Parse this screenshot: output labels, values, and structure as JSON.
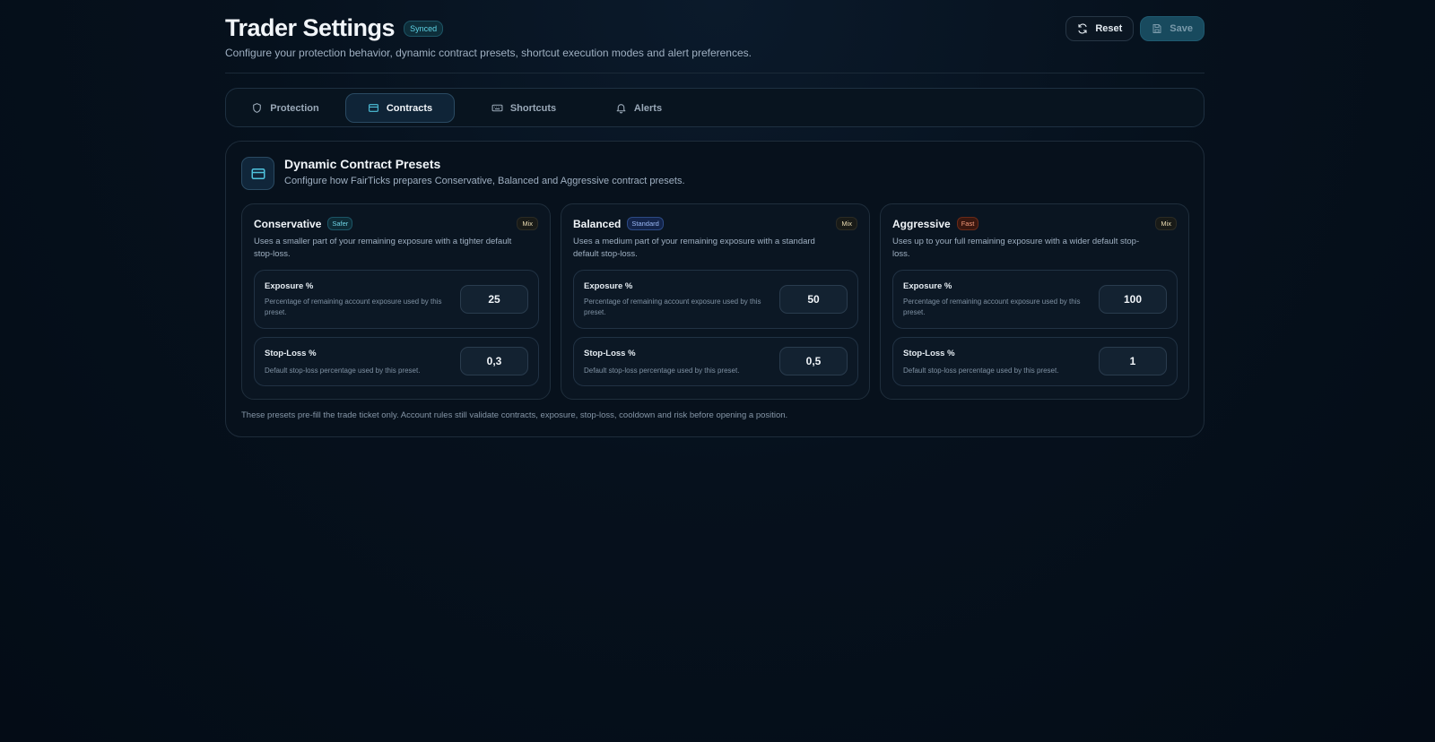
{
  "header": {
    "title": "Trader Settings",
    "status_badge": "Synced",
    "subtitle": "Configure your protection behavior, dynamic contract presets, shortcut execution modes and alert preferences.",
    "reset_label": "Reset",
    "save_label": "Save"
  },
  "tabs": [
    {
      "label": "Protection",
      "icon": "shield-icon"
    },
    {
      "label": "Contracts",
      "icon": "card-icon",
      "active": true
    },
    {
      "label": "Shortcuts",
      "icon": "keyboard-icon"
    },
    {
      "label": "Alerts",
      "icon": "bell-icon"
    }
  ],
  "panel": {
    "title": "Dynamic Contract Presets",
    "description": "Configure how FairTicks prepares Conservative, Balanced and Aggressive contract presets.",
    "footnote": "These presets pre-fill the trade ticket only. Account rules still validate contracts, exposure, stop-loss, cooldown and risk before opening a position.",
    "presets": [
      {
        "name": "Conservative",
        "tag": "Safer",
        "mix": "Mix",
        "description": "Uses a smaller part of your remaining exposure with a tighter default stop-loss.",
        "exposure_label": "Exposure %",
        "exposure_help": "Percentage of remaining account exposure used by this preset.",
        "exposure_value": "25",
        "stoploss_label": "Stop-Loss %",
        "stoploss_help": "Default stop-loss percentage used by this preset.",
        "stoploss_value": "0,3"
      },
      {
        "name": "Balanced",
        "tag": "Standard",
        "mix": "Mix",
        "description": "Uses a medium part of your remaining exposure with a standard default stop-loss.",
        "exposure_label": "Exposure %",
        "exposure_help": "Percentage of remaining account exposure used by this preset.",
        "exposure_value": "50",
        "stoploss_label": "Stop-Loss %",
        "stoploss_help": "Default stop-loss percentage used by this preset.",
        "stoploss_value": "0,5"
      },
      {
        "name": "Aggressive",
        "tag": "Fast",
        "mix": "Mix",
        "description": "Uses up to your full remaining exposure with a wider default stop-loss.",
        "exposure_label": "Exposure %",
        "exposure_help": "Percentage of remaining account exposure used by this preset.",
        "exposure_value": "100",
        "stoploss_label": "Stop-Loss %",
        "stoploss_help": "Default stop-loss percentage used by this preset.",
        "stoploss_value": "1"
      }
    ]
  },
  "colors": {
    "accent": "#4fc3dd",
    "background": "#06111d",
    "save_button": "#184a5e"
  }
}
